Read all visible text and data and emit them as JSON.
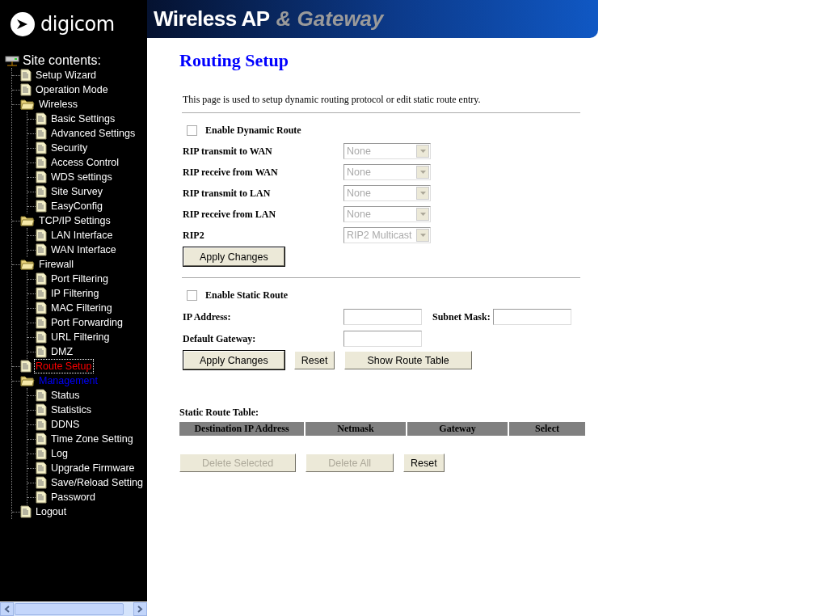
{
  "header": {
    "logo_text": "digicom",
    "title": "Wireless AP",
    "title_accent": "& Gateway"
  },
  "sidebar": {
    "title": "Site contents:",
    "items": [
      {
        "label": "Setup Wizard",
        "kind": "page",
        "selected": false,
        "active": false
      },
      {
        "label": "Operation Mode",
        "kind": "page",
        "selected": false,
        "active": false
      },
      {
        "label": "Wireless",
        "kind": "folder",
        "selected": false,
        "active": false,
        "children": [
          {
            "label": "Basic Settings",
            "kind": "page",
            "selected": false,
            "active": false
          },
          {
            "label": "Advanced Settings",
            "kind": "page",
            "selected": false,
            "active": false
          },
          {
            "label": "Security",
            "kind": "page",
            "selected": false,
            "active": false
          },
          {
            "label": "Access Control",
            "kind": "page",
            "selected": false,
            "active": false
          },
          {
            "label": "WDS settings",
            "kind": "page",
            "selected": false,
            "active": false
          },
          {
            "label": "Site Survey",
            "kind": "page",
            "selected": false,
            "active": false
          },
          {
            "label": "EasyConfig",
            "kind": "page",
            "selected": false,
            "active": false
          }
        ]
      },
      {
        "label": "TCP/IP Settings",
        "kind": "folder",
        "selected": false,
        "active": false,
        "children": [
          {
            "label": "LAN Interface",
            "kind": "page",
            "selected": false,
            "active": false
          },
          {
            "label": "WAN Interface",
            "kind": "page",
            "selected": false,
            "active": false
          }
        ]
      },
      {
        "label": "Firewall",
        "kind": "folder",
        "selected": false,
        "active": false,
        "children": [
          {
            "label": "Port Filtering",
            "kind": "page",
            "selected": false,
            "active": false
          },
          {
            "label": "IP Filtering",
            "kind": "page",
            "selected": false,
            "active": false
          },
          {
            "label": "MAC Filtering",
            "kind": "page",
            "selected": false,
            "active": false
          },
          {
            "label": "Port Forwarding",
            "kind": "page",
            "selected": false,
            "active": false
          },
          {
            "label": "URL Filtering",
            "kind": "page",
            "selected": false,
            "active": false
          },
          {
            "label": "DMZ",
            "kind": "page",
            "selected": false,
            "active": false
          }
        ]
      },
      {
        "label": "Route Setup",
        "kind": "page",
        "selected": true,
        "active": false
      },
      {
        "label": "Management",
        "kind": "folder",
        "selected": false,
        "active": true,
        "children": [
          {
            "label": "Status",
            "kind": "page",
            "selected": false,
            "active": false
          },
          {
            "label": "Statistics",
            "kind": "page",
            "selected": false,
            "active": false
          },
          {
            "label": "DDNS",
            "kind": "page",
            "selected": false,
            "active": false
          },
          {
            "label": "Time Zone Setting",
            "kind": "page",
            "selected": false,
            "active": false
          },
          {
            "label": "Log",
            "kind": "page",
            "selected": false,
            "active": false
          },
          {
            "label": "Upgrade Firmware",
            "kind": "page",
            "selected": false,
            "active": false
          },
          {
            "label": "Save/Reload Setting",
            "kind": "page",
            "selected": false,
            "active": false
          },
          {
            "label": "Password",
            "kind": "page",
            "selected": false,
            "active": false
          }
        ]
      },
      {
        "label": "Logout",
        "kind": "page",
        "selected": false,
        "active": false
      }
    ]
  },
  "page": {
    "title": "Routing Setup",
    "description": "This page is used to setup dynamic routing protocol or edit static route entry."
  },
  "dynamic_route": {
    "enable": {
      "label": "Enable Dynamic Route",
      "checked": false
    },
    "fields": [
      {
        "label": "RIP transmit to WAN",
        "value": "None",
        "disabled": true
      },
      {
        "label": "RIP receive from WAN",
        "value": "None",
        "disabled": true
      },
      {
        "label": "RIP transmit to LAN",
        "value": "None",
        "disabled": true
      },
      {
        "label": "RIP receive from LAN",
        "value": "None",
        "disabled": true
      },
      {
        "label": "RIP2",
        "value": "RIP2 Multicast",
        "disabled": true
      }
    ],
    "buttons": [
      {
        "label": "Apply Changes",
        "kind": "default",
        "disabled": false
      }
    ]
  },
  "static_route": {
    "enable": {
      "label": "Enable Static Route",
      "checked": false
    },
    "ip_address": {
      "label": "IP Address:"
    },
    "subnet_mask": {
      "label": "Subnet Mask:"
    },
    "default_gateway": {
      "label": "Default Gateway:"
    },
    "buttons": [
      {
        "label": "Apply Changes",
        "kind": "default",
        "disabled": false
      },
      {
        "label": "Reset",
        "kind": "normal",
        "disabled": false
      },
      {
        "label": "Show Route Table",
        "kind": "wide",
        "disabled": false
      }
    ]
  },
  "route_table": {
    "title": "Static Route Table:",
    "columns": [
      "Destination IP Address",
      "Netmask",
      "Gateway",
      "Select"
    ],
    "buttons": [
      {
        "label": "Delete Selected",
        "kind": "wide",
        "disabled": true
      },
      {
        "label": "Delete All",
        "kind": "wide",
        "disabled": true
      },
      {
        "label": "Reset",
        "kind": "normal",
        "disabled": false
      }
    ]
  }
}
